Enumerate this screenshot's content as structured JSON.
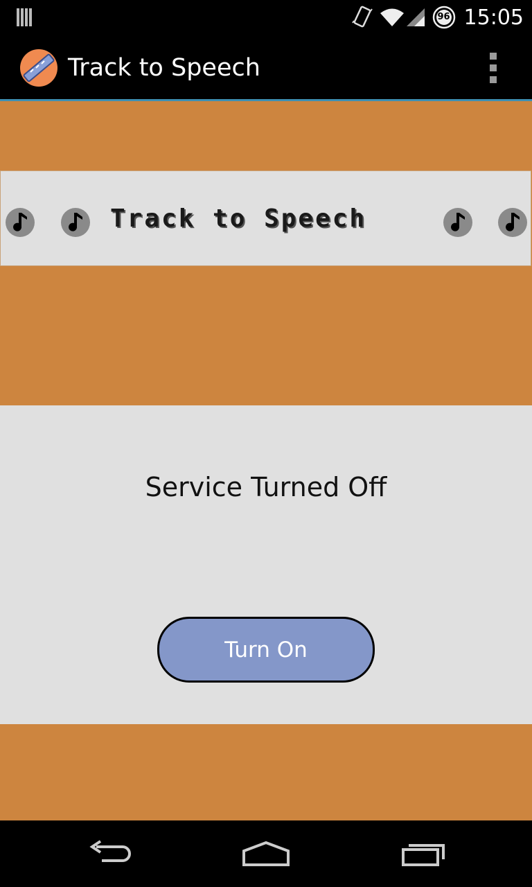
{
  "status_bar": {
    "time": "15:05",
    "battery_level": "96",
    "icons": [
      "barcode-notification-icon",
      "vibrate-icon",
      "wifi-icon",
      "signal-icon",
      "battery-icon"
    ]
  },
  "action_bar": {
    "title": "Track to Speech",
    "logo_icon": "app-logo-icon",
    "menu_icon": "overflow-menu-icon"
  },
  "banner": {
    "text": "Track to Speech",
    "note_icon": "music-note-icon"
  },
  "service": {
    "status_text": "Service Turned Off",
    "button_label": "Turn On",
    "button_color": "#8497c9"
  },
  "nav_bar": {
    "icons": [
      "back-icon",
      "home-icon",
      "recent-apps-icon"
    ]
  },
  "colors": {
    "background": "#cd853f",
    "panel": "#e0e0e0",
    "action_bar": "#000000",
    "divider": "#3e8fb3"
  }
}
